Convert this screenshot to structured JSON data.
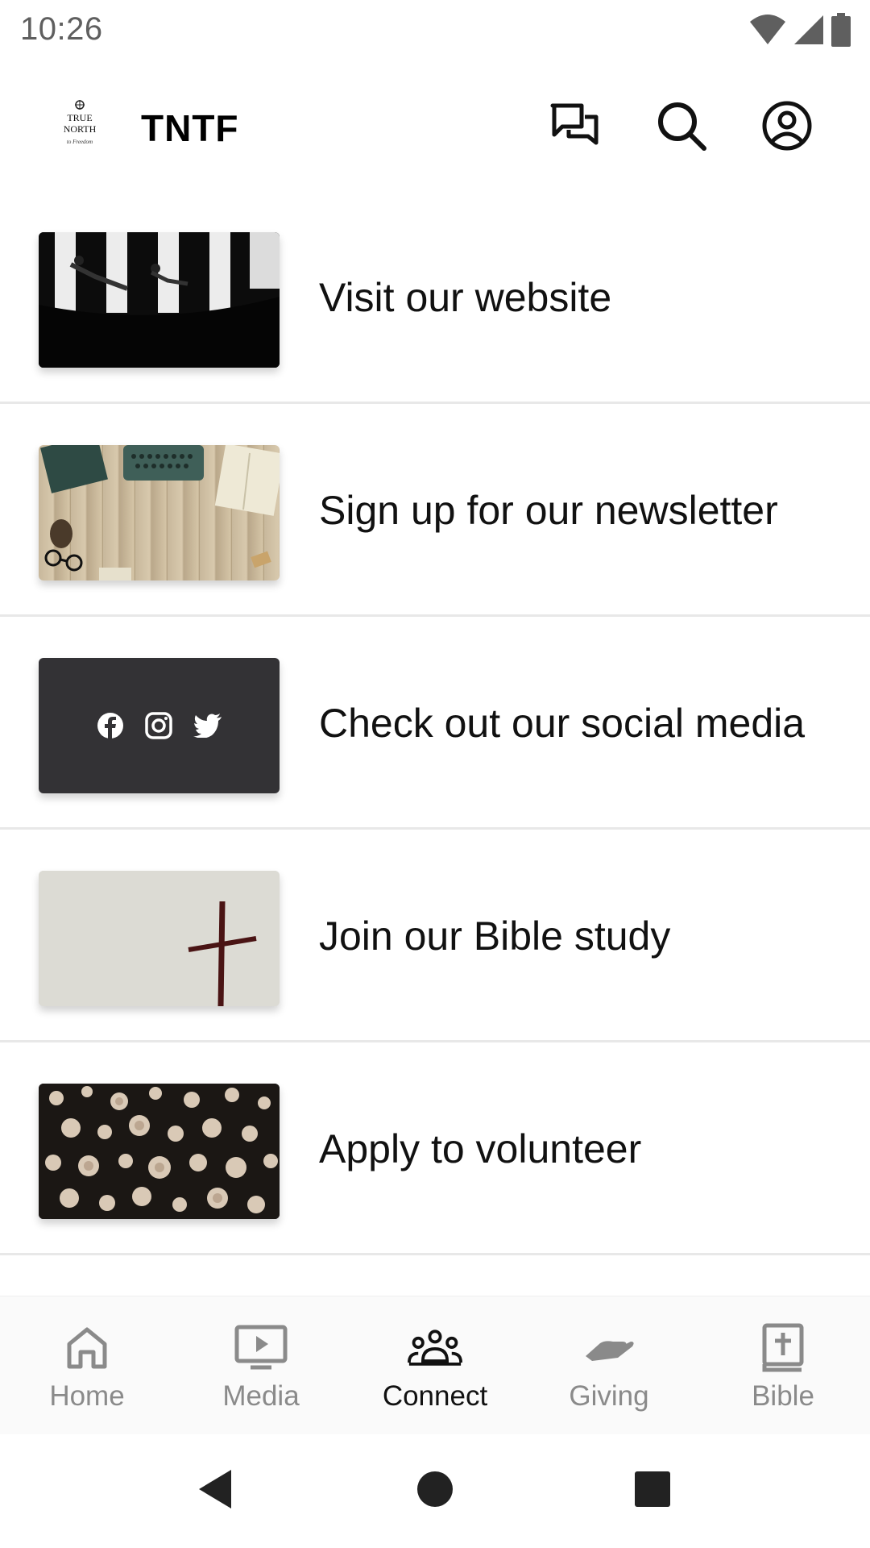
{
  "status_bar": {
    "time": "10:26"
  },
  "app_bar": {
    "title": "TNTF",
    "logo_text": [
      "TRUE",
      "NORTH",
      "to Freedom"
    ]
  },
  "list": {
    "items": [
      {
        "label": "Visit our website",
        "image": "black-white-crosswalk-photo"
      },
      {
        "label": "Sign up for our newsletter",
        "image": "typewriter-desk-photo"
      },
      {
        "label": "Check out our social media",
        "image": "social-icons-card"
      },
      {
        "label": "Join our Bible study",
        "image": "cross-photo"
      },
      {
        "label": "Apply to volunteer",
        "image": "log-stack-photo"
      }
    ]
  },
  "bottom_nav": {
    "items": [
      {
        "label": "Home",
        "icon": "home-icon",
        "active": false
      },
      {
        "label": "Media",
        "icon": "media-icon",
        "active": false
      },
      {
        "label": "Connect",
        "icon": "people-icon",
        "active": true
      },
      {
        "label": "Giving",
        "icon": "giving-hand-icon",
        "active": false
      },
      {
        "label": "Bible",
        "icon": "bible-icon",
        "active": false
      }
    ]
  },
  "colors": {
    "active": "#111111",
    "inactive": "#8a8a8a",
    "divider": "#e8e8e8",
    "social_card": "#333235"
  }
}
